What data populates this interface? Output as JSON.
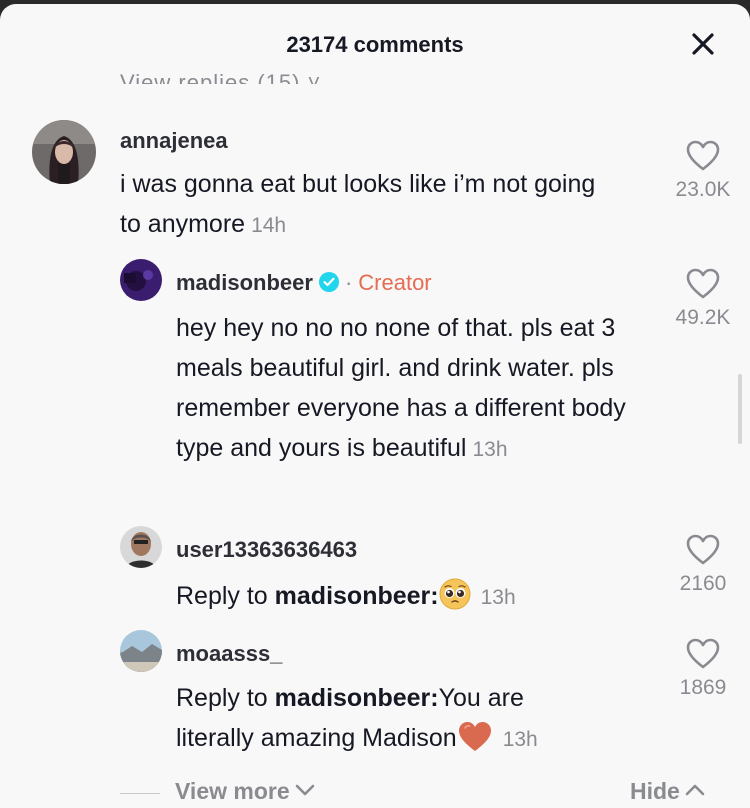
{
  "header": {
    "title": "23174 comments"
  },
  "partial_row_text": "View replies (15) ˅",
  "comments": [
    {
      "username": "annajenea",
      "text": "i was gonna eat but looks like i’m not going to anymore",
      "timestamp": "14h",
      "likes": "23.0K"
    }
  ],
  "replies": [
    {
      "username": "madisonbeer",
      "creator_label": "Creator",
      "separator": "·",
      "text": "hey hey no no no none of that. pls eat 3 meals beautiful girl. and drink water. pls remember everyone has a different body type and yours is beautiful",
      "timestamp": "13h",
      "likes": "49.2K"
    },
    {
      "username": "user13363636463",
      "reply_prefix": "Reply to ",
      "reply_to": "madisonbeer:",
      "text": "",
      "timestamp": "13h",
      "likes": "2160"
    },
    {
      "username": "moaasss_",
      "reply_prefix": "Reply to ",
      "reply_to": "madisonbeer:",
      "text_line1": "You are",
      "text_line2": "literally amazing Madison",
      "timestamp": "13h",
      "likes": "1869"
    }
  ],
  "footer": {
    "view_more": "View more",
    "hide": "Hide"
  },
  "colors": {
    "creator": "#e46d53",
    "verified": "#20d5ec",
    "muted": "#8a8b91"
  }
}
